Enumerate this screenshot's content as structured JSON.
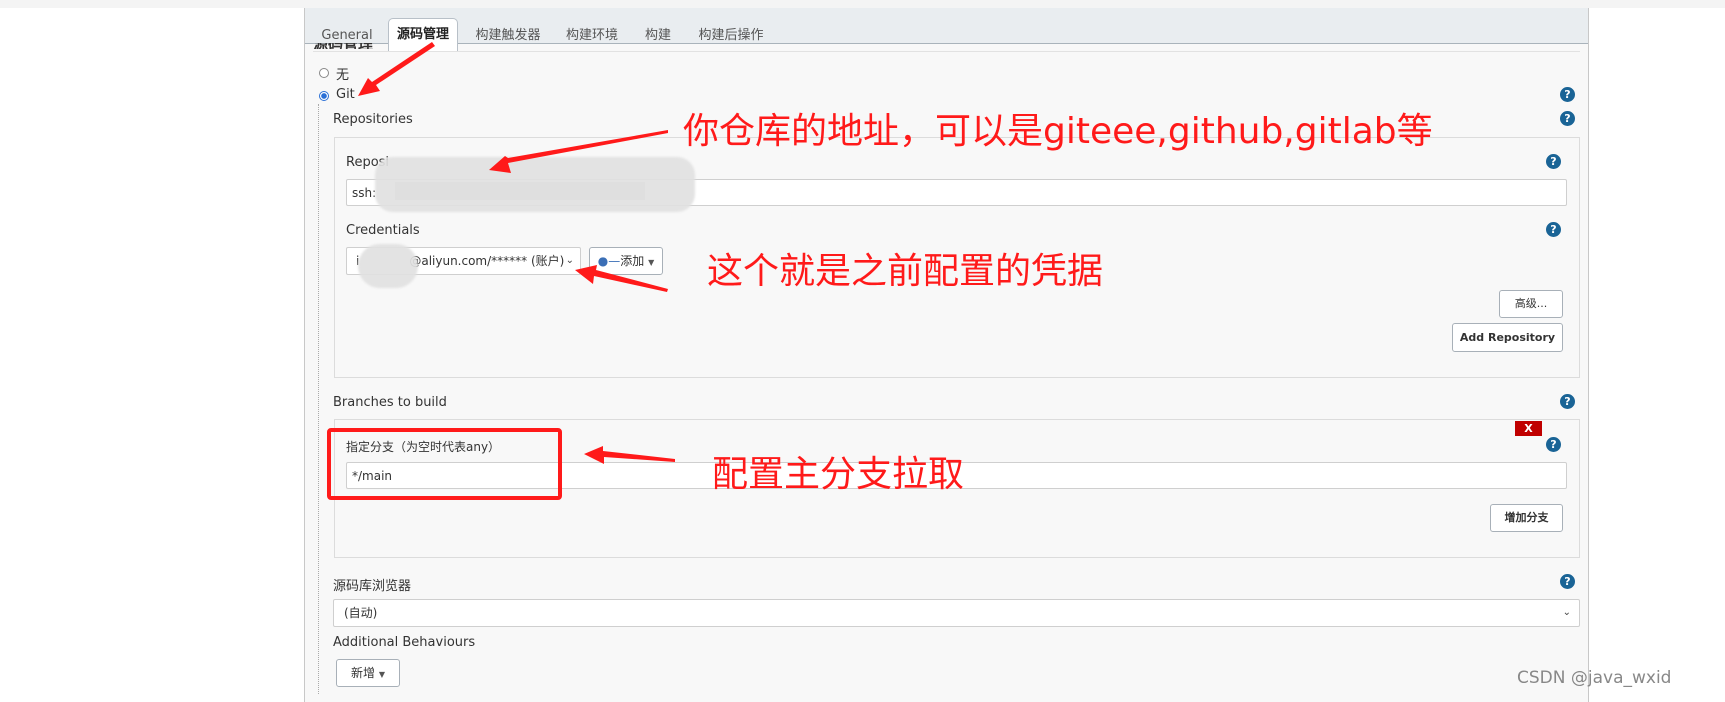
{
  "tabs": [
    {
      "label": "General",
      "active": false
    },
    {
      "label": "源码管理",
      "active": true
    },
    {
      "label": "构建触发器",
      "active": false
    },
    {
      "label": "构建环境",
      "active": false
    },
    {
      "label": "构建",
      "active": false
    },
    {
      "label": "构建后操作",
      "active": false
    }
  ],
  "section_title": "源码管理",
  "scm": {
    "options": [
      {
        "label": "无",
        "checked": false
      },
      {
        "label": "Git",
        "checked": true
      }
    ],
    "repositories_label": "Repositories",
    "repository_url_label": "Reposi",
    "repository_url_value": "ssh:",
    "credentials_label": "Credentials",
    "credentials_value_prefix": "i",
    "credentials_value_suffix": "@aliyun.com/****** (账户)",
    "add_credentials_label": "添加",
    "advanced_label": "高级...",
    "add_repository_label": "Add Repository",
    "branches_label": "Branches to build",
    "branch_delete_label": "X",
    "branch_specifier_label": "指定分支（为空时代表any）",
    "branch_specifier_value": "*/main",
    "add_branch_label": "增加分支",
    "browser_label": "源码库浏览器",
    "browser_value": "(自动)",
    "additional_behaviours_label": "Additional Behaviours",
    "add_behaviour_label": "新增"
  },
  "help_icon_glyph": "?",
  "annotations": {
    "repo_note": "你仓库的地址，可以是giteee,github,gitlab等",
    "credentials_note": "这个就是之前配置的凭据",
    "branch_note": "配置主分支拉取",
    "annotation_color": "#ff1a1a"
  },
  "watermark": "CSDN @java_wxid"
}
